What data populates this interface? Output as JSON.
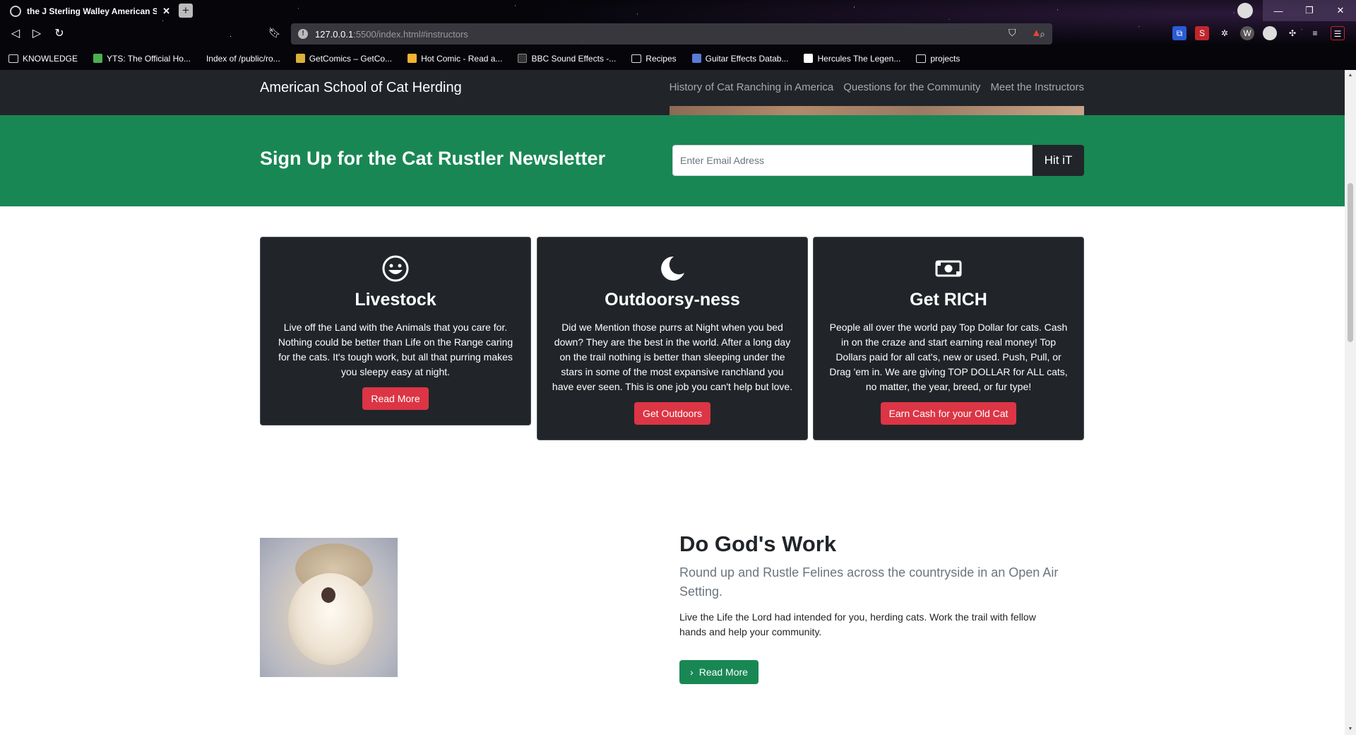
{
  "browser": {
    "tab_title": "the J Sterling Walley American Sc",
    "url_host": "127.0.0.1",
    "url_path": ":5500/index.html#instructors",
    "bookmarks": [
      "KNOWLEDGE",
      "YTS: The Official Ho...",
      "Index of /public/ro...",
      "GetComics – GetCo...",
      "Hot Comic - Read a...",
      "BBC Sound Effects -...",
      "Recipes",
      "Guitar Effects Datab...",
      "Hercules The Legen...",
      "projects"
    ]
  },
  "navbar": {
    "brand": "American School of Cat Herding",
    "links": [
      "History of Cat Ranching in America",
      "Questions for the Community",
      "Meet the Instructors"
    ]
  },
  "newsletter": {
    "title": "Sign Up for the Cat Rustler Newsletter",
    "placeholder": "Enter Email Adress",
    "button": "Hit iT"
  },
  "cards": [
    {
      "icon": "emoji-laughing-icon",
      "title": "Livestock",
      "text": "Live off the Land with the Animals that you care for. Nothing could be better than Life on the Range caring for the cats. It's tough work, but all that purring makes you sleepy easy at night.",
      "button": "Read More"
    },
    {
      "icon": "moon-icon",
      "title": "Outdoorsy-ness",
      "text": "Did we Mention those purrs at Night when you bed down? They are the best in the world. After a long day on the trail nothing is better than sleeping under the stars in some of the most expansive ranchland you have ever seen. This is one job you can't help but love.",
      "button": "Get Outdoors"
    },
    {
      "icon": "cash-icon",
      "title": "Get RICH",
      "text": "People all over the world pay Top Dollar for cats. Cash in on the craze and start earning real money! Top Dollars paid for all cat's, new or used. Push, Pull, or Drag 'em in. We are giving TOP DOLLAR for ALL cats, no matter, the year, breed, or fur type!",
      "button": "Earn Cash for your Old Cat"
    }
  ],
  "feature": {
    "title": "Do God's Work",
    "lead": "Round up and Rustle Felines across the countryside in an Open Air Setting.",
    "text": "Live the Life the Lord had intended for you, herding cats. Work the trail with fellow hands and help your community.",
    "button": "Read More"
  },
  "colors": {
    "dark": "#212529",
    "green": "#198754",
    "red": "#dc3545"
  }
}
